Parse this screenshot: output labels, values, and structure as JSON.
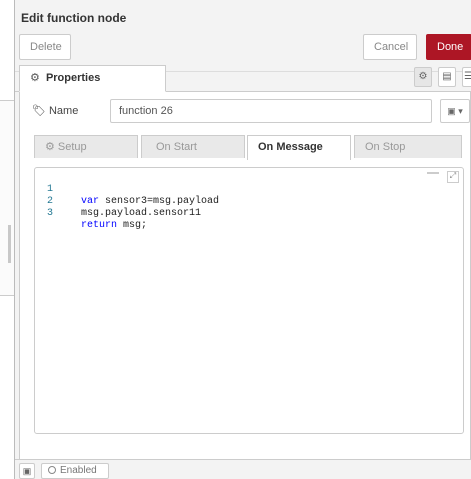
{
  "tray": {
    "title": "Edit function node",
    "delete_label": "Delete",
    "cancel_label": "Cancel",
    "done_label": "Done",
    "done_color": "#ad1625"
  },
  "tabs": {
    "properties_label": "Properties",
    "properties_icon": "gear-icon",
    "icon_buttons": [
      "gear-icon",
      "document-icon",
      "list-icon"
    ]
  },
  "name_field": {
    "label": "Name",
    "label_icon": "tag-icon",
    "value": "function 26",
    "icon_button": "book-icon"
  },
  "subtabs": [
    {
      "label": "Setup",
      "icon": "gear-icon",
      "active": false
    },
    {
      "label": "On Start",
      "active": false
    },
    {
      "label": "On Message",
      "active": true
    },
    {
      "label": "On Stop",
      "active": false
    }
  ],
  "editor": {
    "lines": [
      {
        "number": "1",
        "keyword": "var",
        "text": " sensor3=msg.payload"
      },
      {
        "number": "2",
        "keyword": "",
        "text": "msg.payload.sensor11"
      },
      {
        "number": "3",
        "keyword": "return",
        "text": " msg;"
      }
    ]
  },
  "footer": {
    "enabled_label": "Enabled",
    "icon": "book-icon"
  }
}
